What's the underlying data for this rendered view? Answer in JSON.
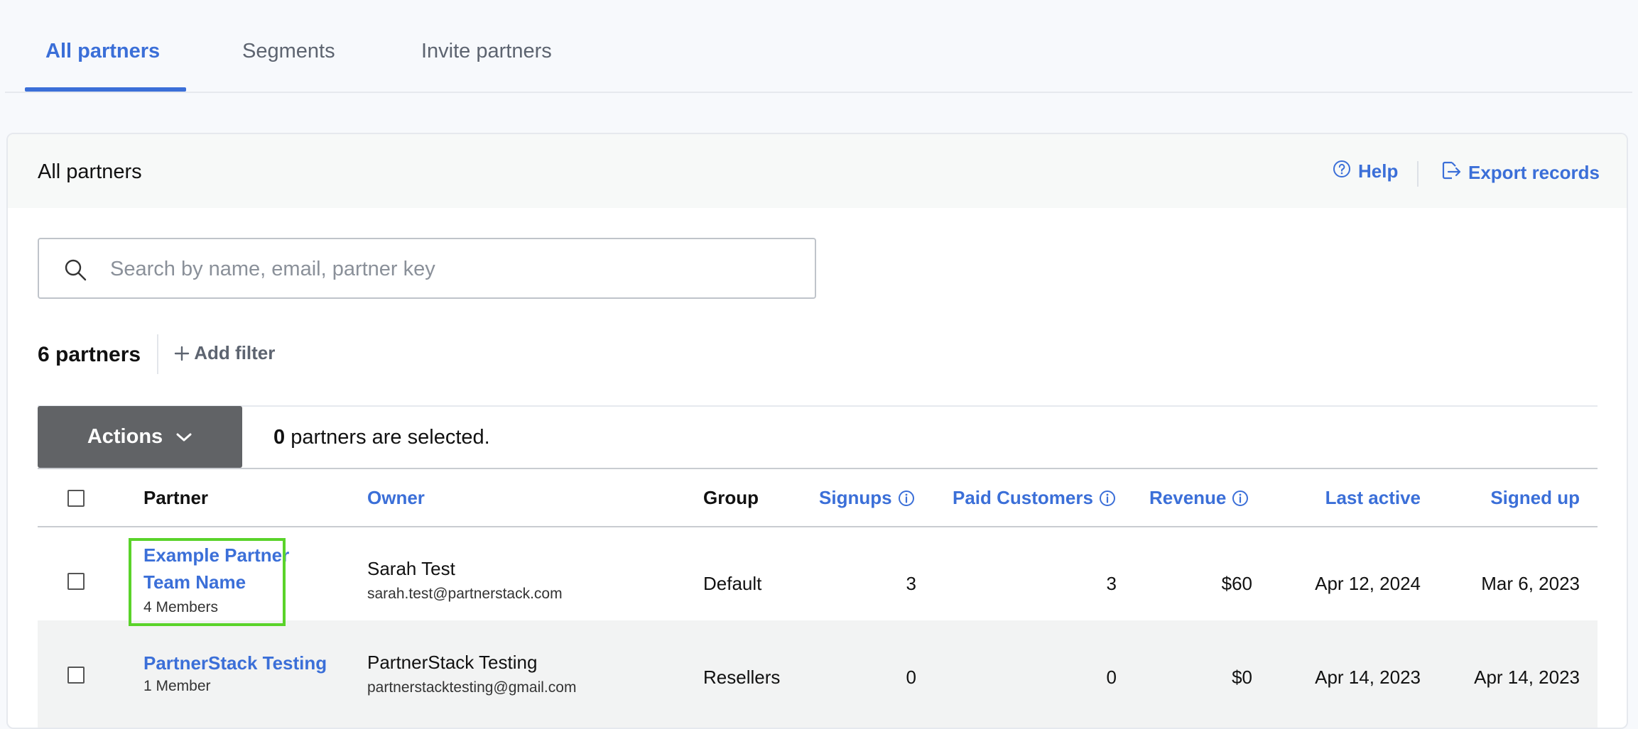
{
  "tabs": [
    {
      "label": "All partners"
    },
    {
      "label": "Segments"
    },
    {
      "label": "Invite partners"
    }
  ],
  "card": {
    "title": "All partners",
    "help_label": "Help",
    "export_label": "Export records"
  },
  "search": {
    "placeholder": "Search by name, email, partner key",
    "value": ""
  },
  "summary": {
    "count_label": "6 partners",
    "add_filter_label": "Add filter"
  },
  "toolbar": {
    "actions_label": "Actions",
    "selected_count": "0",
    "selected_suffix": "partners are selected."
  },
  "table": {
    "headers": {
      "partner": "Partner",
      "owner": "Owner",
      "group": "Group",
      "signups": "Signups",
      "paid_customers": "Paid Customers",
      "revenue": "Revenue",
      "last_active": "Last active",
      "signed_up": "Signed up"
    },
    "rows": [
      {
        "partner_name": "Example Partner Team Name",
        "members": "4 Members",
        "owner_name": "Sarah Test",
        "owner_email": "sarah.test@partnerstack.com",
        "group": "Default",
        "signups": "3",
        "paid_customers": "3",
        "revenue": "$60",
        "last_active": "Apr 12, 2024",
        "signed_up": "Mar 6, 2023"
      },
      {
        "partner_name": "PartnerStack Testing",
        "members": "1 Member",
        "owner_name": "PartnerStack Testing",
        "owner_email": "partnerstacktesting@gmail.com",
        "group": "Resellers",
        "signups": "0",
        "paid_customers": "0",
        "revenue": "$0",
        "last_active": "Apr 14, 2023",
        "signed_up": "Apr 14, 2023"
      }
    ]
  },
  "colors": {
    "accent": "#3b6fd8",
    "highlight": "#5ad32a",
    "actions_button": "#616366"
  }
}
